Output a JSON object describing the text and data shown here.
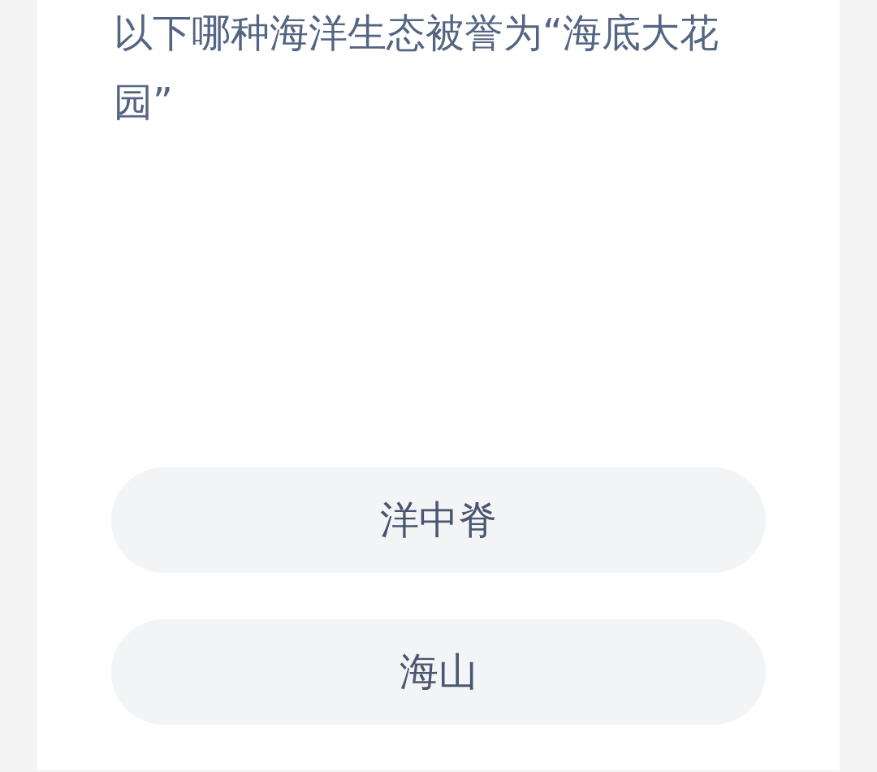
{
  "question": "以下哪种海洋生态被誉为“海底大花园”",
  "options": [
    {
      "label": "洋中脊"
    },
    {
      "label": "海山"
    }
  ]
}
